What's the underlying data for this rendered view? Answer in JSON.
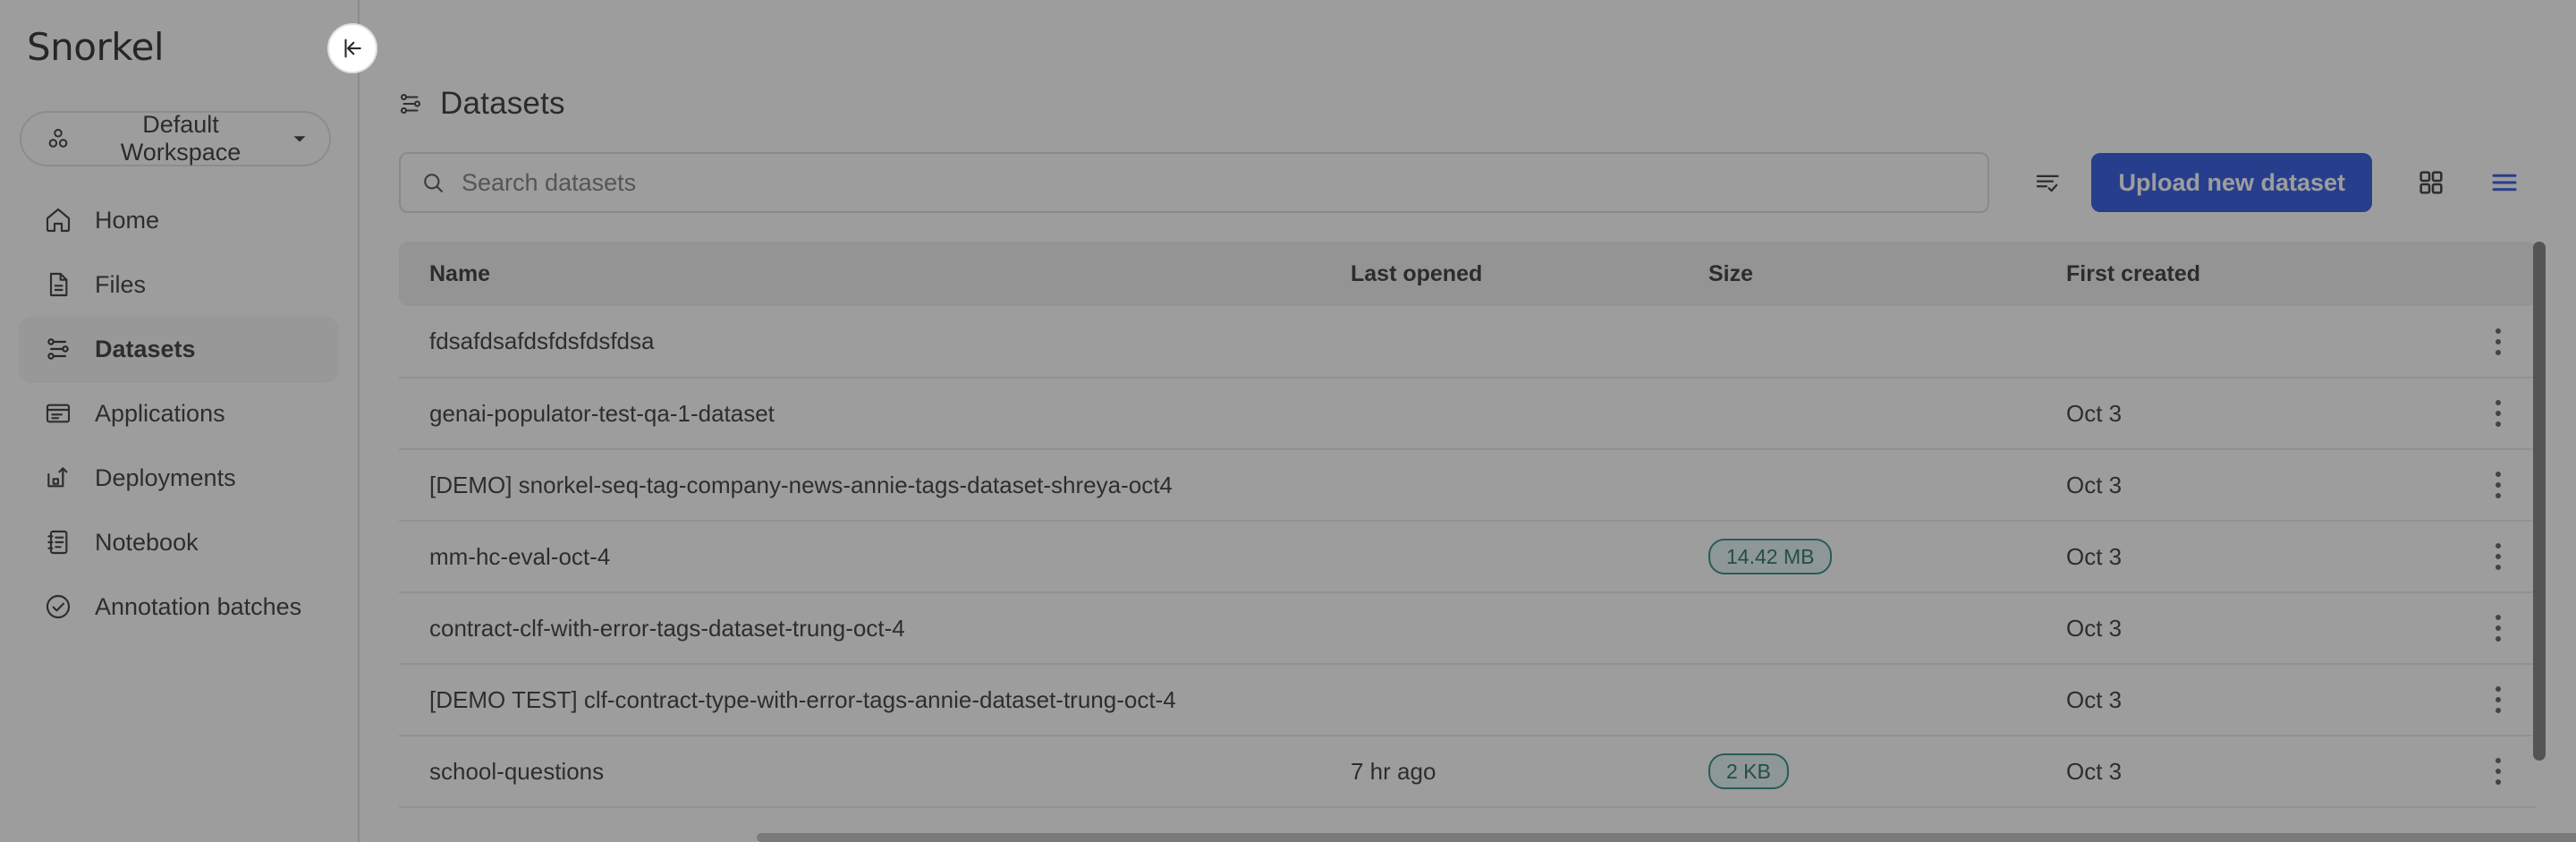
{
  "app": {
    "brand": "Snorkel",
    "collapse_icon": "collapse-sidebar-icon"
  },
  "sidebar": {
    "workspace": {
      "label": "Default Workspace",
      "icon": "workspace-icon",
      "chevron": "chevron-down-icon"
    },
    "items": [
      {
        "label": "Home",
        "icon": "home-icon",
        "active": false
      },
      {
        "label": "Files",
        "icon": "file-icon",
        "active": false
      },
      {
        "label": "Datasets",
        "icon": "datasets-sliders-icon",
        "active": true
      },
      {
        "label": "Applications",
        "icon": "applications-window-icon",
        "active": false
      },
      {
        "label": "Deployments",
        "icon": "deployments-upload-icon",
        "active": false
      },
      {
        "label": "Notebook",
        "icon": "notebook-icon",
        "active": false
      },
      {
        "label": "Annotation batches",
        "icon": "check-circle-icon",
        "active": false
      }
    ]
  },
  "header": {
    "title": "Datasets",
    "title_icon": "datasets-sliders-icon"
  },
  "toolbar": {
    "search_placeholder": "Search datasets",
    "search_value": "",
    "search_icon": "search-icon",
    "filter_icon": "sort-filter-icon",
    "upload_label": "Upload new dataset",
    "grid_view_icon": "grid-view-icon",
    "list_view_icon": "list-view-icon",
    "active_view": "list"
  },
  "colors": {
    "accent_blue": "#1340df",
    "pill_border": "#157d74",
    "pill_text": "#0d5f58",
    "pill_bg": "#dff3f0",
    "table_header_bg": "#ececec",
    "scrim": "rgba(60,60,60,0.50)"
  },
  "table": {
    "columns": [
      "Name",
      "Last opened",
      "Size",
      "First created",
      ""
    ],
    "rows": [
      {
        "name": "fdsafdsafdsfdsfdsfdsa",
        "last_opened": "",
        "size": "",
        "first_created": ""
      },
      {
        "name": "genai-populator-test-qa-1-dataset",
        "last_opened": "",
        "size": "",
        "first_created": "Oct 3"
      },
      {
        "name": "[DEMO] snorkel-seq-tag-company-news-annie-tags-dataset-shreya-oct4",
        "last_opened": "",
        "size": "",
        "first_created": "Oct 3"
      },
      {
        "name": "mm-hc-eval-oct-4",
        "last_opened": "",
        "size": "14.42 MB",
        "first_created": "Oct 3"
      },
      {
        "name": "contract-clf-with-error-tags-dataset-trung-oct-4",
        "last_opened": "",
        "size": "",
        "first_created": "Oct 3"
      },
      {
        "name": "[DEMO TEST] clf-contract-type-with-error-tags-annie-dataset-trung-oct-4",
        "last_opened": "",
        "size": "",
        "first_created": "Oct 3"
      },
      {
        "name": "school-questions",
        "last_opened": "7 hr ago",
        "size": "2 KB",
        "first_created": "Oct 3"
      }
    ],
    "row_menu_icon": "kebab-menu-icon"
  }
}
